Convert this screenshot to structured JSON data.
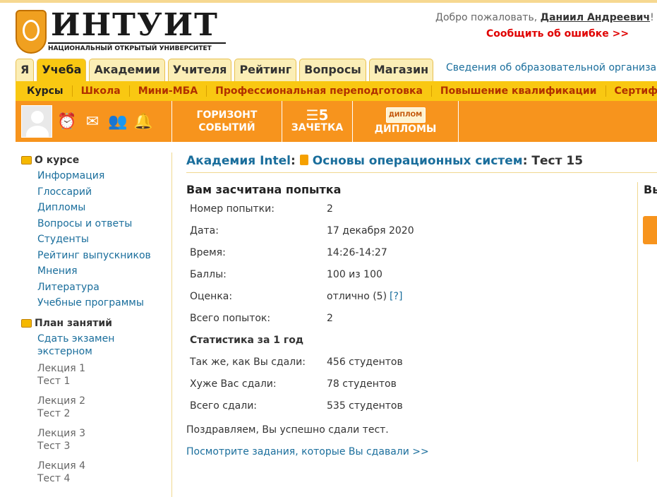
{
  "header": {
    "logo_text": "ИНТУИТ",
    "logo_subtitle": "НАЦИОНАЛЬНЫЙ ОТКРЫТЫЙ УНИВЕРСИТЕТ",
    "welcome_prefix": "Добро пожаловать,",
    "user_name": "Даниил Андреевич",
    "welcome_suffix": "! (Вы",
    "report_error": "Сообщить об ошибке >>"
  },
  "tabs": [
    {
      "label": "Я",
      "active": false
    },
    {
      "label": "Учеба",
      "active": true
    },
    {
      "label": "Академии",
      "active": false
    },
    {
      "label": "Учителя",
      "active": false
    },
    {
      "label": "Рейтинг",
      "active": false
    },
    {
      "label": "Вопросы",
      "active": false
    },
    {
      "label": "Магазин",
      "active": false
    }
  ],
  "info_link": "Сведения об образовательной организации",
  "subnav": [
    "Курсы",
    "Школа",
    "Мини-МБА",
    "Профессиональная переподготовка",
    "Повышение квалификации",
    "Сертификация"
  ],
  "iconbar": {
    "horizon_line1": "ГОРИЗОНТ",
    "horizon_line2": "СОБЫТИЙ",
    "gradebook": "ЗАЧЕТКА",
    "gradebook_number": "5",
    "diplomas": "ДИПЛОМЫ",
    "diploma_card_label": "ДИПЛОМ"
  },
  "sidebar": {
    "about_title": "О курсе",
    "about_links": [
      "Информация",
      "Глоссарий",
      "Дипломы",
      "Вопросы и ответы",
      "Студенты",
      "Рейтинг выпускников",
      "Мнения",
      "Литература",
      "Учебные программы"
    ],
    "plan_title": "План занятий",
    "plan_exam_line1": "Сдать экзамен",
    "plan_exam_line2": "экстерном",
    "lessons": [
      {
        "lecture": "Лекция 1",
        "test": "Тест 1"
      },
      {
        "lecture": "Лекция 2",
        "test": "Тест 2"
      },
      {
        "lecture": "Лекция 3",
        "test": "Тест 3"
      },
      {
        "lecture": "Лекция 4",
        "test": "Тест 4"
      }
    ]
  },
  "breadcrumb": {
    "academy": "Академия Intel",
    "course": "Основы операционных систем",
    "current": "Тест 15"
  },
  "result": {
    "title": "Вам засчитана попытка",
    "rows": [
      {
        "key": "Номер попытки:",
        "value": "2"
      },
      {
        "key": "Дата:",
        "value": "17 декабря 2020"
      },
      {
        "key": "Время:",
        "value": "14:26-14:27"
      },
      {
        "key": "Баллы:",
        "value": "100 из 100"
      },
      {
        "key": "Оценка:",
        "value": "отлично (5)",
        "hint": "[?]"
      },
      {
        "key": "Всего попыток:",
        "value": "2"
      }
    ],
    "stats_title": "Статистика за 1 год",
    "stats": [
      {
        "key": "Так же, как Вы сдали:",
        "value": "456 студентов"
      },
      {
        "key": "Хуже Вас сдали:",
        "value": "78 студентов"
      },
      {
        "key": "Всего сдали:",
        "value": "535 студентов"
      }
    ],
    "congrats": "Поздравляем, Вы успешно сдали тест.",
    "see_tasks": "Посмотрите задания, которые Вы сдавали >>"
  },
  "right_panel": {
    "title": "Вы"
  }
}
